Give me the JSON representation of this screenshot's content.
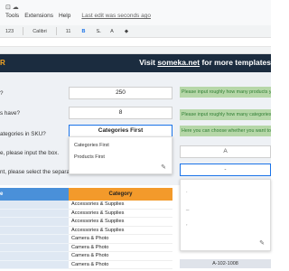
{
  "menubar": {
    "items": [
      "Tools",
      "Extensions",
      "Help"
    ],
    "last_edit": "Last edit was seconds ago"
  },
  "toolbar": {
    "format": "123",
    "font": "Calibri",
    "size": "11",
    "bold": "B",
    "text_color": "A"
  },
  "banner": {
    "left_letter": "R",
    "visit_prefix": "Visit ",
    "visit_link": "someka.net",
    "visit_suffix": " for more templates"
  },
  "form": {
    "questions": [
      "?",
      "s have?",
      "ategories in SKU?",
      "e, please input the box.",
      "nt, please select the separator"
    ],
    "inputs": [
      "250",
      "8",
      "Categories First"
    ],
    "hints": [
      "Please input roughly how many products you",
      "Please input roughly how many categories",
      "Here you can choose whether you want to"
    ],
    "right_cell": "A",
    "right_cell_2": "-"
  },
  "dropdown": {
    "options": [
      "Categories First",
      "Products First"
    ],
    "edit_icon": "pencil-icon"
  },
  "popup": {
    "dots": [
      ".",
      "_",
      ","
    ],
    "edit_icon": "pencil-icon"
  },
  "table": {
    "headers": [
      "e",
      "Category"
    ],
    "rows": [
      "Accessories & Supplies",
      "Accessories & Supplies",
      "Accessories & Supplies",
      "Accessories & Supplies",
      "Camera & Photo",
      "Camera & Photo",
      "Camera & Photo",
      "Camera & Photo",
      "Camera & Photo"
    ],
    "sku": "A-102-1008"
  },
  "colors": {
    "banner": "#1b2c3f",
    "header_blue": "#4a90d9",
    "header_orange": "#f39a2b",
    "hint_green": "#b6d7a8",
    "accent": "#1a73e8"
  }
}
